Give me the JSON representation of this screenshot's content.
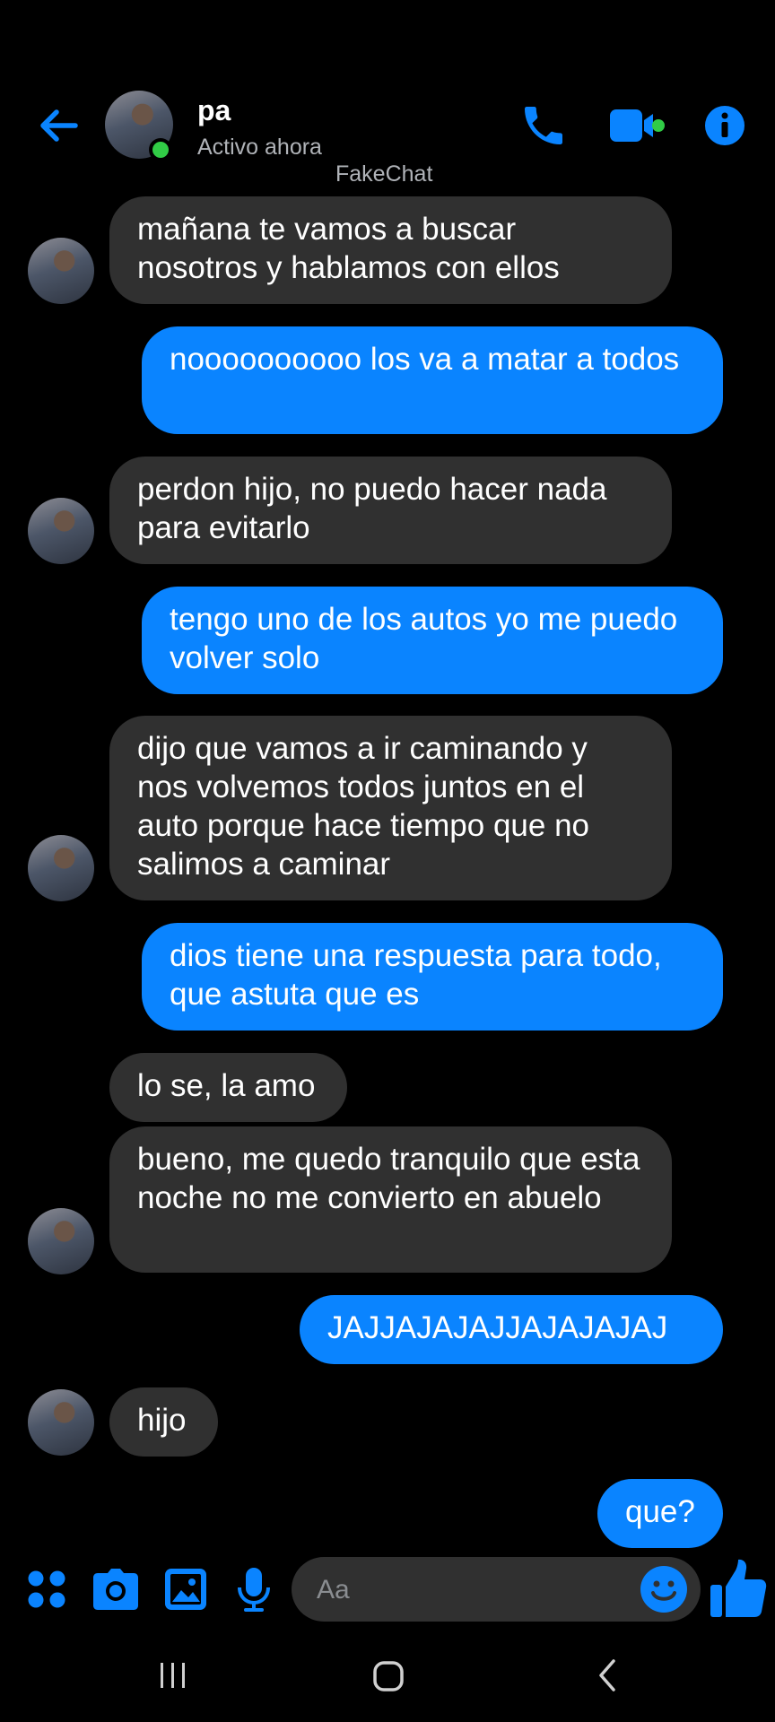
{
  "colors": {
    "accent": "#0a84ff",
    "received_bubble": "#303030",
    "online": "#31cc46",
    "background": "#000000"
  },
  "header": {
    "contact_name": "pa",
    "status": "Activo ahora",
    "watermark": "FakeChat",
    "icons": [
      "back-arrow-icon",
      "phone-icon",
      "video-call-icon",
      "info-icon"
    ]
  },
  "messages": [
    {
      "from": "contact",
      "text": "mañana te vamos a buscar nosotros y hablamos con ellos"
    },
    {
      "from": "me",
      "text": "noooooooooo los va a matar a todos"
    },
    {
      "from": "contact",
      "text": "perdon hijo, no puedo hacer nada para evitarlo"
    },
    {
      "from": "me",
      "text": "tengo uno de los autos yo me puedo volver solo"
    },
    {
      "from": "contact",
      "text": "dijo que vamos a ir caminando y nos volvemos todos juntos en el auto porque hace tiempo que no salimos a caminar"
    },
    {
      "from": "me",
      "text": "dios tiene una respuesta para todo, que astuta que es"
    },
    {
      "from": "contact",
      "text": "lo se, la amo"
    },
    {
      "from": "contact",
      "text": "bueno, me quedo tranquilo que esta noche no me convierto en abuelo"
    },
    {
      "from": "me",
      "text": "JAJJAJAJAJJAJAJAJAJ"
    },
    {
      "from": "contact",
      "text": "hijo"
    },
    {
      "from": "me",
      "text": "que?"
    }
  ],
  "composer": {
    "placeholder": "Aa",
    "icons": [
      "apps-icon",
      "camera-icon",
      "gallery-icon",
      "microphone-icon",
      "emoji-icon",
      "thumbs-up-icon"
    ]
  },
  "navbar": {
    "icons": [
      "recent-apps-icon",
      "home-icon",
      "back-icon"
    ]
  }
}
